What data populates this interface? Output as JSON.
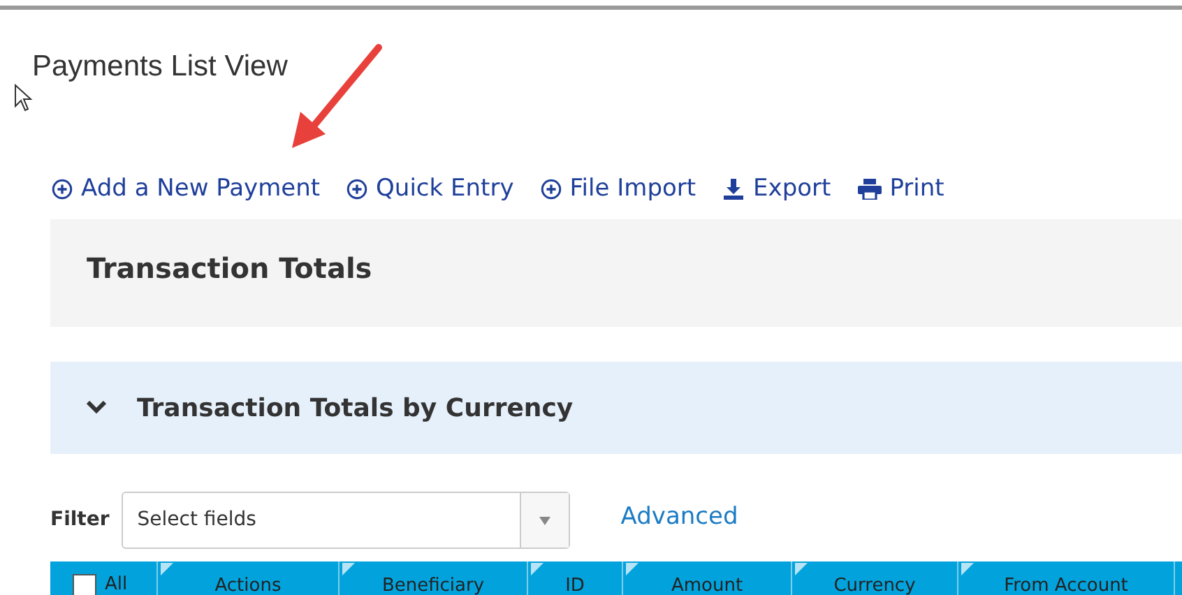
{
  "page_title": "Payments List View",
  "toolbar": [
    {
      "kind": "add",
      "label": "Add a New Payment"
    },
    {
      "kind": "add",
      "label": "Quick Entry"
    },
    {
      "kind": "add",
      "label": "File Import"
    },
    {
      "kind": "download",
      "label": "Export"
    },
    {
      "kind": "print",
      "label": "Print"
    }
  ],
  "totals_panel": {
    "title": "Transaction Totals"
  },
  "currency_panel": {
    "title": "Transaction Totals by Currency",
    "expanded": true
  },
  "filter": {
    "label": "Filter",
    "placeholder": "Select fields",
    "advanced_link": "Advanced"
  },
  "table": {
    "select_all": {
      "label": "All",
      "checked": false
    },
    "columns": [
      "Actions",
      "Beneficiary",
      "ID",
      "Amount",
      "Currency",
      "From Account"
    ]
  }
}
